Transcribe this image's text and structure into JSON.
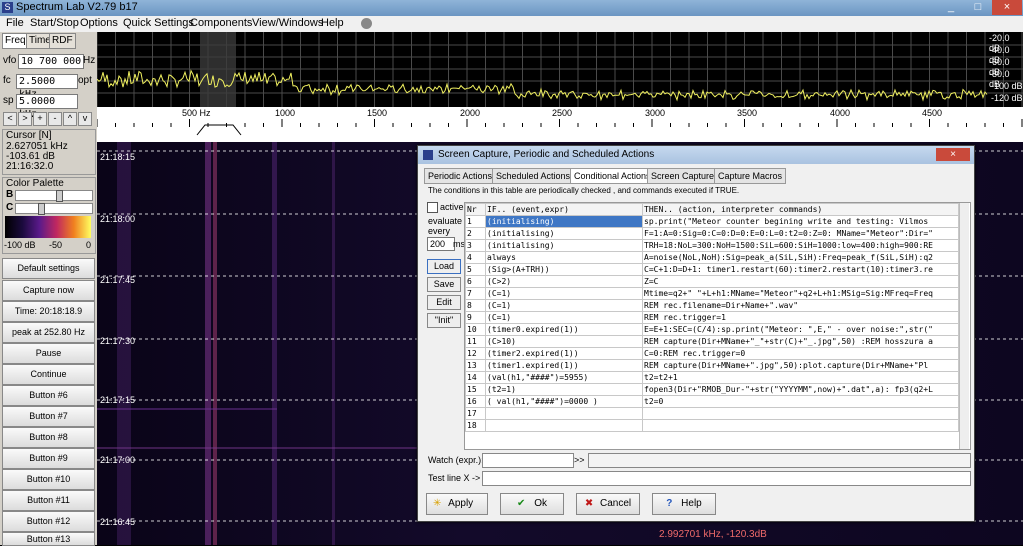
{
  "app": {
    "title": "Spectrum Lab V2.79 b17",
    "window_controls": [
      "_",
      "□",
      "×"
    ]
  },
  "menu": [
    "File",
    "Start/Stop",
    "Options",
    "Quick Settings",
    "Components",
    "View/Windows",
    "Help"
  ],
  "left": {
    "tabs": [
      "Freq",
      "Time",
      "RDF"
    ],
    "vfo": {
      "label": "vfo",
      "value": "10 700 000",
      "unit": "Hz"
    },
    "fc": {
      "label": "fc",
      "value": "2.5000 kHz",
      "unit": "opt"
    },
    "sp": {
      "label": "sp",
      "value": "5.0000 kHz"
    },
    "step_buttons": [
      "<",
      ">",
      "+",
      "-",
      "^",
      "v"
    ],
    "cursor": {
      "title": "Cursor [N]",
      "freq": "2.627051 kHz",
      "level": "-103.61 dB",
      "time": "21:16:32.0"
    },
    "palette": {
      "title": "Color Palette",
      "b": "B",
      "c": "C",
      "min": "-100 dB",
      "mid": "-50",
      "max": "0"
    },
    "buttons": [
      "Default settings",
      "Capture now",
      "Time:  20:18:18.9",
      "peak at 252.80 Hz",
      "Pause",
      "Continue",
      "Button #6",
      "Button #7",
      "Button #8",
      "Button #9",
      "Button #10",
      "Button #11",
      "Button #12",
      "Button #13"
    ]
  },
  "spectrum": {
    "db_labels": [
      "-20.0 dB",
      "-40.0 dB",
      "-60.0 dB",
      "-80.0 dB",
      "-100 dB",
      "-120 dB"
    ],
    "freq_labels": [
      "500 Hz",
      "1000",
      "1500",
      "2000",
      "2500",
      "3000",
      "3500",
      "4000",
      "4500"
    ]
  },
  "waterfall": {
    "times": [
      "21:18:15",
      "21:18:00",
      "21:17:45",
      "21:17:30",
      "21:17:15",
      "21:17:00",
      "21:16:45"
    ],
    "readout": "2.992701 kHz, -120.3dB"
  },
  "dialog": {
    "title": "Screen Capture, Periodic and Scheduled Actions",
    "tabs": [
      "Periodic Actions",
      "Scheduled Actions",
      "Conditional Actions",
      "Screen Capture",
      "Capture Macros"
    ],
    "description": "The conditions in this table are periodically checked , and commands executed if TRUE.",
    "active_label": "active",
    "evaluate_label": "evaluate every",
    "interval_value": "200",
    "interval_unit": "ms",
    "side_buttons": [
      "Load",
      "Save",
      "Edit",
      "\"Init\""
    ],
    "columns": [
      "Nr",
      "IF..  (event,expr)",
      "THEN..  (action, interpreter commands)"
    ],
    "rows": [
      [
        "1",
        "(initialising)",
        "sp.print(\"Meteor counter begining write and testing: Vilmos"
      ],
      [
        "2",
        "(initialising)",
        "F=1:A=0:Sig=0:C=0:D=0:E=0:L=0:t2=0:Z=0: MName=\"Meteor\":Dir=\""
      ],
      [
        "3",
        "(initialising)",
        "TRH=18:NoL=300:NoH=1500:SiL=600:SiH=1000:low=400:high=900:RE"
      ],
      [
        "4",
        "always",
        "A=noise(NoL,NoH):Sig=peak_a(SiL,SiH):Freq=peak_f(SiL,SiH):q2"
      ],
      [
        "5",
        "(Sig>(A+TRH))",
        "C=C+1:D=D+1: timer1.restart(60):timer2.restart(10):timer3.re"
      ],
      [
        "6",
        "(C>2)",
        "Z=C"
      ],
      [
        "7",
        "(C=1)",
        "Mtime=q2+\" \"+L+h1:MName=\"Meteor\"+q2+L+h1:MSig=Sig:MFreq=Freq"
      ],
      [
        "8",
        "(C=1)",
        "REM rec.filename=Dir+Name+\".wav\""
      ],
      [
        "9",
        "(C=1)",
        "REM rec.trigger=1"
      ],
      [
        "10",
        "(timer0.expired(1))",
        "E=E+1:SEC=(C/4):sp.print(\"Meteor: \",E,\" - over noise:\",str(\""
      ],
      [
        "11",
        "(C>10)",
        "REM capture(Dir+MName+\"_\"+str(C)+\"_.jpg\",50) :REM hosszura a"
      ],
      [
        "12",
        "(timer2.expired(1))",
        "C=0:REM rec.trigger=0"
      ],
      [
        "13",
        "(timer1.expired(1))",
        "REM capture(Dir+MName+\".jpg\",50):plot.capture(Dir+MName+\"Pl"
      ],
      [
        "14",
        "(val(h1,\"####\")=5955)",
        "t2=t2+1"
      ],
      [
        "15",
        "(t2=1)",
        "fopen3(Dir+\"RMOB_Dur-\"+str(\"YYYYMM\",now)+\".dat\",a): fp3(q2+L"
      ],
      [
        "16",
        "( val(h1,\"####\")=0000 )",
        "t2=0"
      ],
      [
        "17",
        "",
        ""
      ],
      [
        "18",
        "",
        ""
      ]
    ],
    "watch_label": "Watch (expr.):",
    "watch_arrow": ">>",
    "testline_label": "Test line X ->",
    "bottom_buttons": [
      {
        "label": "Apply",
        "icon": "✳",
        "color": "#d8a000"
      },
      {
        "label": "Ok",
        "icon": "✔",
        "color": "#1a8a1a"
      },
      {
        "label": "Cancel",
        "icon": "✖",
        "color": "#c01818"
      },
      {
        "label": "Help",
        "icon": "?",
        "color": "#2255bb"
      }
    ]
  }
}
